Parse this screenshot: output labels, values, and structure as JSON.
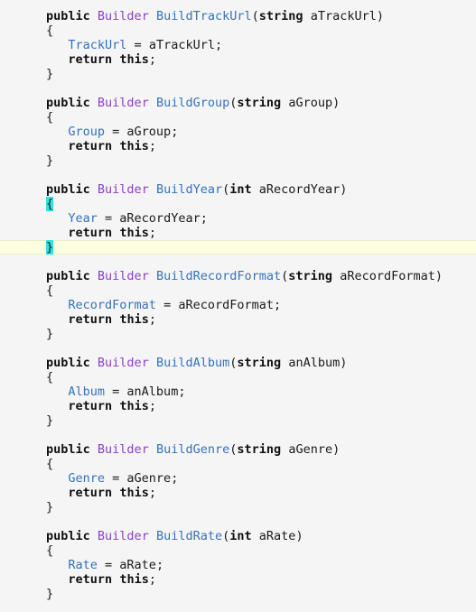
{
  "methods": [
    {
      "kw_public": "public",
      "ret_type": "Builder",
      "name": "BuildTrackUrl",
      "param_type": "string",
      "param_name": "aTrackUrl",
      "field": "TrackUrl",
      "kw_return": "return",
      "kw_this": "this"
    },
    {
      "kw_public": "public",
      "ret_type": "Builder",
      "name": "BuildGroup",
      "param_type": "string",
      "param_name": "aGroup",
      "field": "Group",
      "kw_return": "return",
      "kw_this": "this"
    },
    {
      "kw_public": "public",
      "ret_type": "Builder",
      "name": "BuildYear",
      "param_type": "int",
      "param_name": "aRecordYear",
      "field": "Year",
      "kw_return": "return",
      "kw_this": "this"
    },
    {
      "kw_public": "public",
      "ret_type": "Builder",
      "name": "BuildRecordFormat",
      "param_type": "string",
      "param_name": "aRecordFormat",
      "field": "RecordFormat",
      "kw_return": "return",
      "kw_this": "this"
    },
    {
      "kw_public": "public",
      "ret_type": "Builder",
      "name": "BuildAlbum",
      "param_type": "string",
      "param_name": "anAlbum",
      "field": "Album",
      "kw_return": "return",
      "kw_this": "this"
    },
    {
      "kw_public": "public",
      "ret_type": "Builder",
      "name": "BuildGenre",
      "param_type": "string",
      "param_name": "aGenre",
      "field": "Genre",
      "kw_return": "return",
      "kw_this": "this"
    },
    {
      "kw_public": "public",
      "ret_type": "Builder",
      "name": "BuildRate",
      "param_type": "int",
      "param_name": "aRate",
      "field": "Rate",
      "kw_return": "return",
      "kw_this": "this"
    }
  ],
  "editor": {
    "current_line_method": 2,
    "matched_brace_method": 2,
    "colors": {
      "background": "#f5f5f5",
      "keyword": "#111111",
      "type": "#8c3ec8",
      "identifier": "#3472b8",
      "current_line": "#fdfde0",
      "brace_match": "#33e0e0"
    }
  }
}
